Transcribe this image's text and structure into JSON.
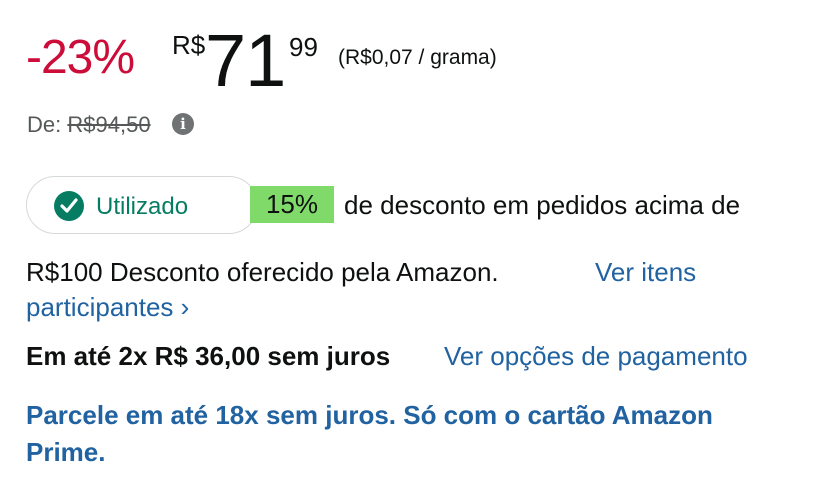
{
  "price": {
    "discount": "-23%",
    "currency": "R$",
    "whole": "71",
    "fraction": "99",
    "unit_price": "(R$0,07 / grama)"
  },
  "list_price": {
    "label": "De:",
    "value": "R$94,50",
    "info_icon": "i"
  },
  "coupon": {
    "status": "Utilizado",
    "percent": "15%",
    "description_line1": "de desconto em pedidos acima de",
    "description_line2": "R$100 Desconto oferecido pela Amazon.",
    "link_line1": "Ver itens",
    "link_line2": "participantes ›",
    "colors": {
      "badge": "#7fda69",
      "check": "#067d62"
    }
  },
  "installments": {
    "text": "Em até 2x R$ 36,00 sem juros",
    "link": "Ver opções de pagamento"
  },
  "prime_offer": {
    "line1": "Parcele em até 18x sem juros. Só com o cartão Amazon",
    "line2": "Prime."
  },
  "colors": {
    "discount": "#cc0c39",
    "link": "#2162a1"
  }
}
